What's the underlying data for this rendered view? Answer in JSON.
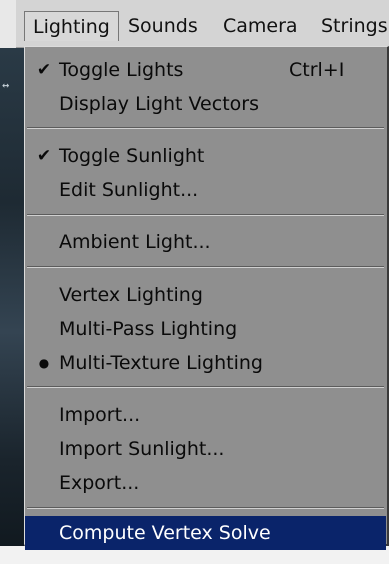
{
  "menubar": {
    "items": [
      {
        "label": "Lighting"
      },
      {
        "label": "Sounds"
      },
      {
        "label": "Camera"
      },
      {
        "label": "Strings"
      }
    ]
  },
  "viewport": {
    "marker": "↔"
  },
  "dropdown": {
    "items": [
      {
        "label": "Toggle Lights",
        "mark": "✔",
        "shortcut": "Ctrl+I"
      },
      {
        "label": "Display Light Vectors"
      },
      {
        "label": "Toggle Sunlight",
        "mark": "✔"
      },
      {
        "label": "Edit Sunlight..."
      },
      {
        "label": "Ambient Light..."
      },
      {
        "label": "Vertex Lighting"
      },
      {
        "label": "Multi-Pass Lighting"
      },
      {
        "label": "Multi-Texture Lighting",
        "mark": "●"
      },
      {
        "label": "Import..."
      },
      {
        "label": "Import Sunlight..."
      },
      {
        "label": "Export..."
      },
      {
        "label": "Compute Vertex Solve"
      }
    ]
  },
  "colors": {
    "highlight": "#0a246a",
    "menu_background": "#8f8f8f",
    "menubar_background": "#d4d4d4"
  }
}
